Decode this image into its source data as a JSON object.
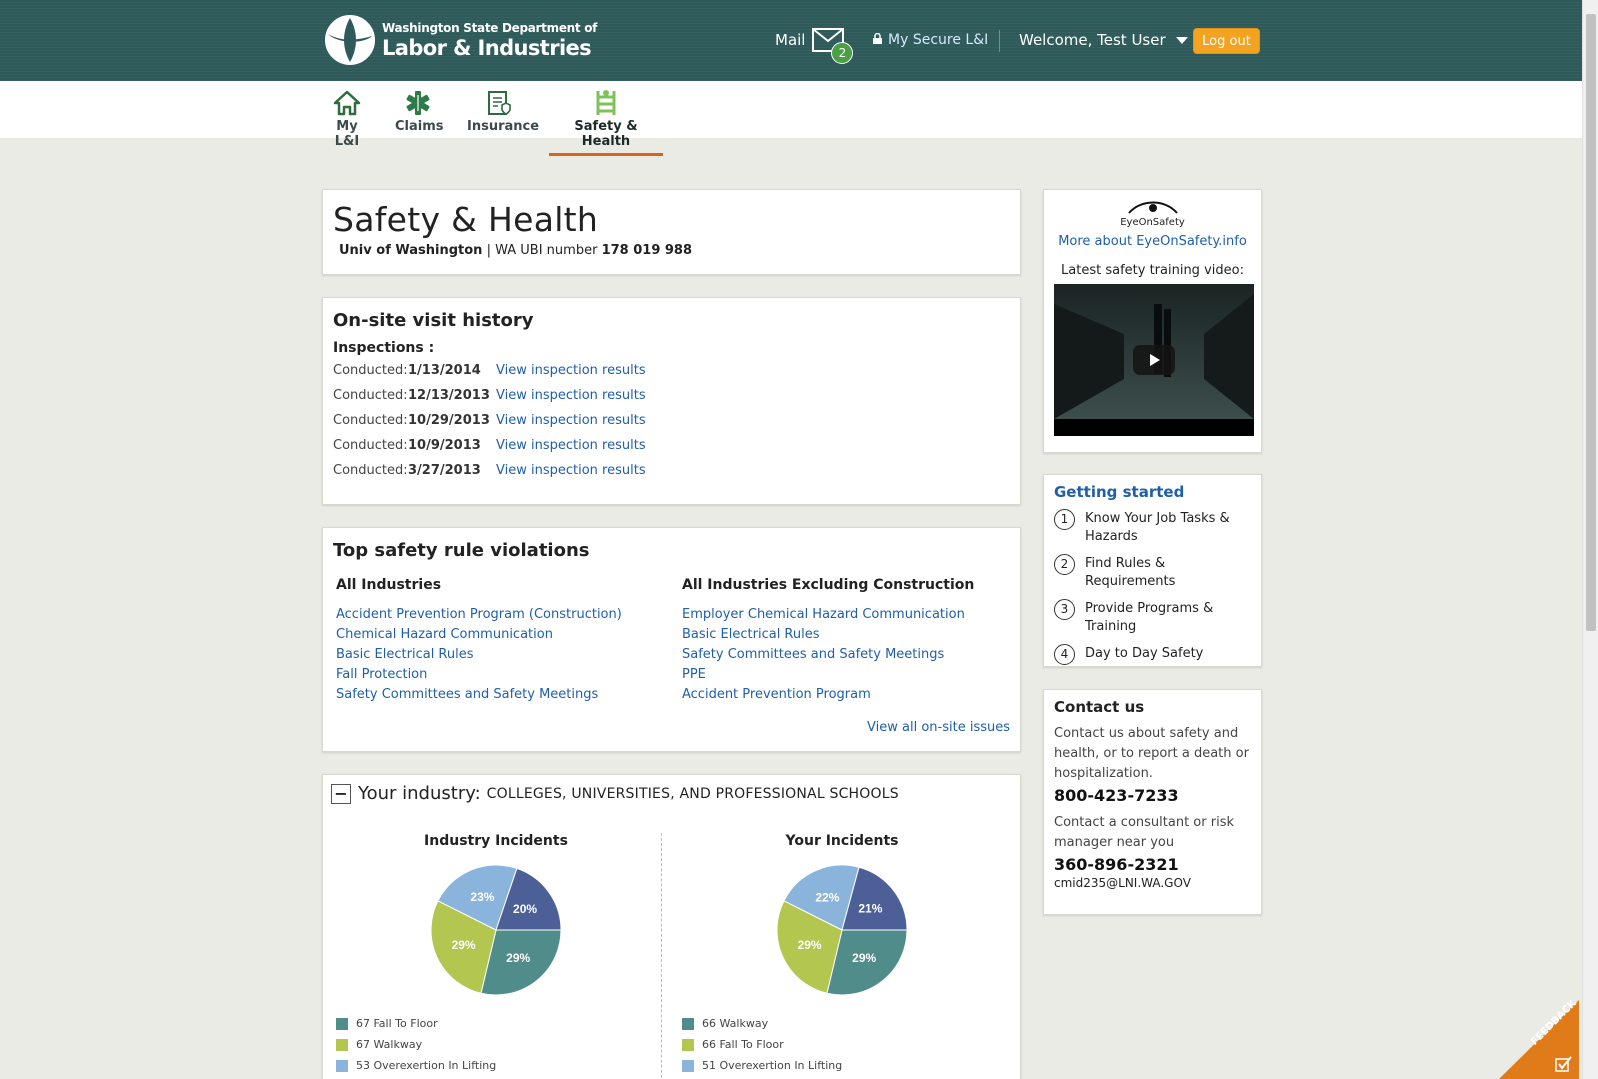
{
  "header": {
    "logo_small": "Washington State Department of",
    "logo_big": "Labor & Industries",
    "mail_label": "Mail",
    "mail_count": "2",
    "secure_label": "My Secure L&I",
    "welcome": "Welcome, Test User",
    "logout": "Log out"
  },
  "nav": {
    "tabs": [
      {
        "label": "My L&I",
        "icon": "home-icon"
      },
      {
        "label": "Claims",
        "icon": "star-of-life-icon"
      },
      {
        "label": "Insurance",
        "icon": "insurance-doc-icon"
      },
      {
        "label": "Safety & Health",
        "icon": "safety-ladder-icon",
        "active": true
      }
    ]
  },
  "page": {
    "title": "Safety & Health",
    "employer": "Univ of Washington",
    "ubi_label": "WA UBI number",
    "ubi_number": "178 019 988"
  },
  "visits": {
    "title": "On-site visit history",
    "inspections_label": "Inspections :",
    "rows": [
      {
        "label": "Conducted:",
        "date": "1/13/2014",
        "link": "View inspection results"
      },
      {
        "label": "Conducted:",
        "date": "12/13/2013",
        "link": "View inspection results"
      },
      {
        "label": "Conducted:",
        "date": "10/29/2013",
        "link": "View inspection results"
      },
      {
        "label": "Conducted:",
        "date": "10/9/2013",
        "link": "View inspection results"
      },
      {
        "label": "Conducted:",
        "date": "3/27/2013",
        "link": "View inspection results"
      }
    ]
  },
  "violations": {
    "title": "Top safety rule violations",
    "col1_title": "All Industries",
    "col1": [
      "Accident Prevention Program (Construction)",
      "Chemical Hazard Communication",
      "Basic Electrical Rules",
      "Fall Protection",
      "Safety Committees and Safety Meetings"
    ],
    "col2_title": "All Industries Excluding Construction",
    "col2": [
      "Employer Chemical Hazard Communication",
      "Basic Electrical Rules",
      "Safety Committees and Safety Meetings",
      "PPE",
      "Accident Prevention Program"
    ],
    "view_all": "View all on-site issues"
  },
  "industry": {
    "label": "Your industry:",
    "name": "COLLEGES, UNIVERSITIES, AND PROFESSIONAL SCHOOLS",
    "toggle": "−"
  },
  "chart_data": [
    {
      "type": "pie",
      "title": "Industry Incidents",
      "slices": [
        {
          "label": "Fall To Floor",
          "count": "67",
          "percent": 29,
          "color": "#4f8c8a"
        },
        {
          "label": "Walkway",
          "count": "67",
          "percent": 29,
          "color": "#b2c650"
        },
        {
          "label": "Overexertion In Lifting",
          "count": "53",
          "percent": 23,
          "color": "#8ab4dc"
        },
        {
          "label": "",
          "count": "",
          "percent": 20,
          "color": "#4d5f97"
        }
      ],
      "legend": [
        {
          "count": "67",
          "label": "Fall To Floor",
          "color": "#4f8c8a"
        },
        {
          "count": "67",
          "label": "Walkway",
          "color": "#b2c650"
        },
        {
          "count": "53",
          "label": "Overexertion In Lifting",
          "color": "#8ab4dc"
        }
      ]
    },
    {
      "type": "pie",
      "title": "Your Incidents",
      "slices": [
        {
          "label": "Walkway",
          "count": "66",
          "percent": 29,
          "color": "#4f8c8a"
        },
        {
          "label": "Fall To Floor",
          "count": "66",
          "percent": 29,
          "color": "#b2c650"
        },
        {
          "label": "Overexertion In Lifting",
          "count": "51",
          "percent": 22,
          "color": "#8ab4dc"
        },
        {
          "label": "",
          "count": "",
          "percent": 21,
          "color": "#4d5f97"
        }
      ],
      "legend": [
        {
          "count": "66",
          "label": "Walkway",
          "color": "#4f8c8a"
        },
        {
          "count": "66",
          "label": "Fall To Floor",
          "color": "#b2c650"
        },
        {
          "count": "51",
          "label": "Overexertion In Lifting",
          "color": "#8ab4dc"
        }
      ]
    }
  ],
  "sidebar": {
    "eye_brand": "EyeOnSafety",
    "eye_link": "More about EyeOnSafety.info",
    "video_label": "Latest safety training video:",
    "getting_started_title": "Getting started",
    "steps": [
      {
        "num": "1",
        "text": "Know Your Job Tasks & Hazards"
      },
      {
        "num": "2",
        "text": "Find Rules & Requirements"
      },
      {
        "num": "3",
        "text": "Provide Programs & Training"
      },
      {
        "num": "4",
        "text": "Day to Day Safety"
      }
    ],
    "contact_title": "Contact us",
    "contact_text1": "Contact us about safety and health, or to report a death or hospitalization.",
    "phone1": "800-423-7233",
    "contact_text2": "Contact a consultant or risk manager near you",
    "phone2": "360-896-2321",
    "email": "cmid235@LNI.WA.GOV"
  },
  "feedback_label": "FEEDBACK",
  "colors": {
    "header_bg": "#2e5a59",
    "accent": "#f3a31f",
    "link": "#1f5fa8",
    "active_tab": "#d9641b"
  }
}
